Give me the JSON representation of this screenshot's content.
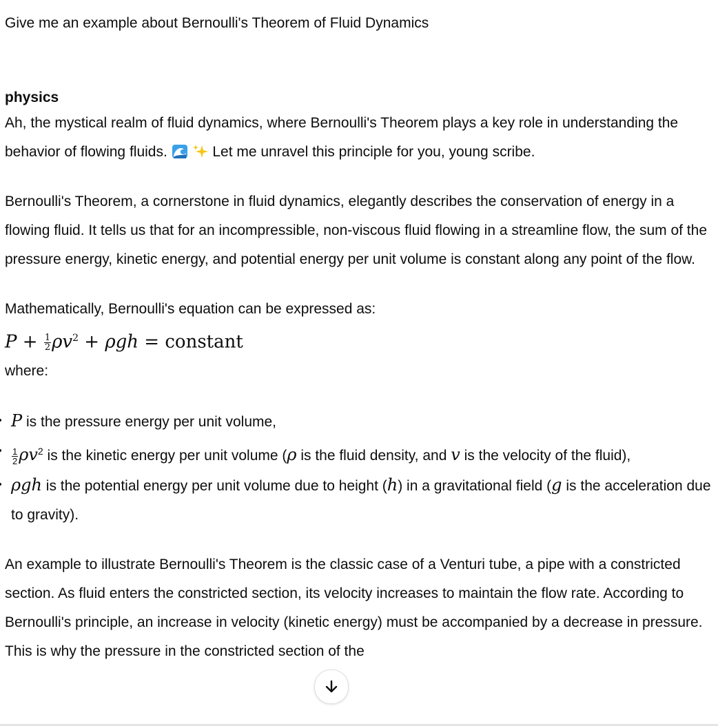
{
  "user_message": "Give me an example about Bernoulli's Theorem of Fluid Dynamics",
  "assistant": {
    "author": "physics",
    "intro_a": "Ah, the mystical realm of fluid dynamics, where Bernoulli's Theorem plays a key role in understanding the behavior of flowing fluids.",
    "intro_b": "Let me unravel this principle for you, young scribe.",
    "intro_icons": [
      "wave-emoji-icon",
      "sparkles-emoji-icon"
    ],
    "para2": "Bernoulli's Theorem, a cornerstone in fluid dynamics, elegantly describes the conservation of energy in a flowing fluid. It tells us that for an incompressible, non-viscous fluid flowing in a streamline flow, the sum of the pressure energy, kinetic energy, and potential energy per unit volume is constant along any point of the flow.",
    "para3": "Mathematically, Bernoulli's equation can be expressed as:",
    "equation_constant": "constant",
    "where": "where:",
    "bullets": {
      "b1_text": " is the pressure energy per unit volume,",
      "b2_text_a": " is the kinetic energy per unit volume (",
      "b2_text_b": " is the fluid density, and ",
      "b2_text_c": " is the velocity of the fluid),",
      "b3_text_a": " is the potential energy per unit volume due to height (",
      "b3_text_b": ") in a gravitational field (",
      "b3_text_c": " is the acceleration due to gravity)."
    },
    "para4": "An example to illustrate Bernoulli's Theorem is the classic case of a Venturi tube, a pipe with a constricted section. As fluid enters the constricted section, its velocity increases to maintain the flow rate. According to Bernoulli's principle, an increase in velocity (kinetic energy) must be accompanied by a decrease in pressure. This is why the pressure in the constricted section of the"
  },
  "scroll_button_icon": "arrow-down-icon"
}
